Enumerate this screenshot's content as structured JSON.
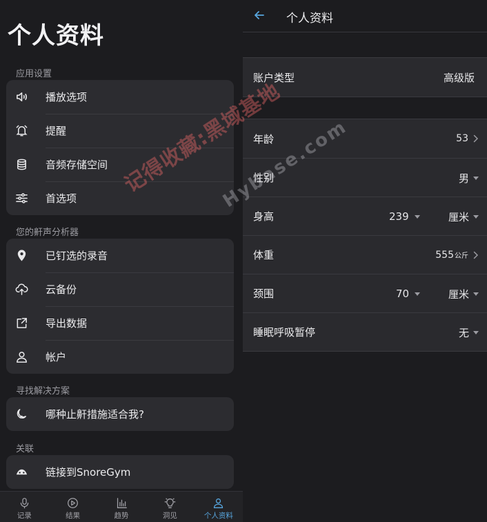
{
  "left": {
    "title": "个人资料",
    "sections": {
      "app_settings": {
        "label": "应用设置",
        "items": [
          {
            "label": "播放选项",
            "icon": "speaker-icon"
          },
          {
            "label": "提醒",
            "icon": "alarm-icon"
          },
          {
            "label": "音频存储空间",
            "icon": "database-icon"
          },
          {
            "label": "首选项",
            "icon": "sliders-icon"
          }
        ]
      },
      "analyzer": {
        "label": "您的鼾声分析器",
        "items": [
          {
            "label": "已钉选的录音",
            "icon": "pin-icon"
          },
          {
            "label": "云备份",
            "icon": "cloud-upload-icon"
          },
          {
            "label": "导出数据",
            "icon": "share-icon"
          },
          {
            "label": "帐户",
            "icon": "user-icon"
          }
        ]
      },
      "solutions": {
        "label": "寻找解决方案",
        "items": [
          {
            "label": "哪种止鼾措施适合我?",
            "icon": "moon-icon"
          }
        ]
      },
      "links": {
        "label": "关联",
        "items": [
          {
            "label": "链接到SnoreGym",
            "icon": "snoregym-icon"
          }
        ]
      }
    },
    "nav": [
      {
        "label": "记录",
        "icon": "microphone-icon",
        "active": false
      },
      {
        "label": "结果",
        "icon": "play-circle-icon",
        "active": false
      },
      {
        "label": "趋势",
        "icon": "bar-chart-icon",
        "active": false
      },
      {
        "label": "洞见",
        "icon": "lightbulb-icon",
        "active": false
      },
      {
        "label": "个人资料",
        "icon": "user-icon",
        "active": true
      }
    ]
  },
  "right": {
    "title": "个人资料",
    "account": {
      "label": "账户类型",
      "value": "高级版"
    },
    "profile": {
      "age": {
        "label": "年龄",
        "value": "53"
      },
      "gender": {
        "label": "性别",
        "value": "男"
      },
      "height": {
        "label": "身高",
        "value": "239",
        "unit": "厘米"
      },
      "weight": {
        "label": "体重",
        "value": "555",
        "unit": "公斤"
      },
      "neck": {
        "label": "颈围",
        "value": "70",
        "unit": "厘米"
      },
      "apnea": {
        "label": "睡眠呼吸暂停",
        "value": "无"
      }
    }
  },
  "watermark": {
    "text1": "记得收藏:黑域基地",
    "text2": "Hybase.com"
  },
  "colors": {
    "accent": "#58a7e0",
    "background": "#1c1c1f",
    "card": "#2c2c30"
  }
}
